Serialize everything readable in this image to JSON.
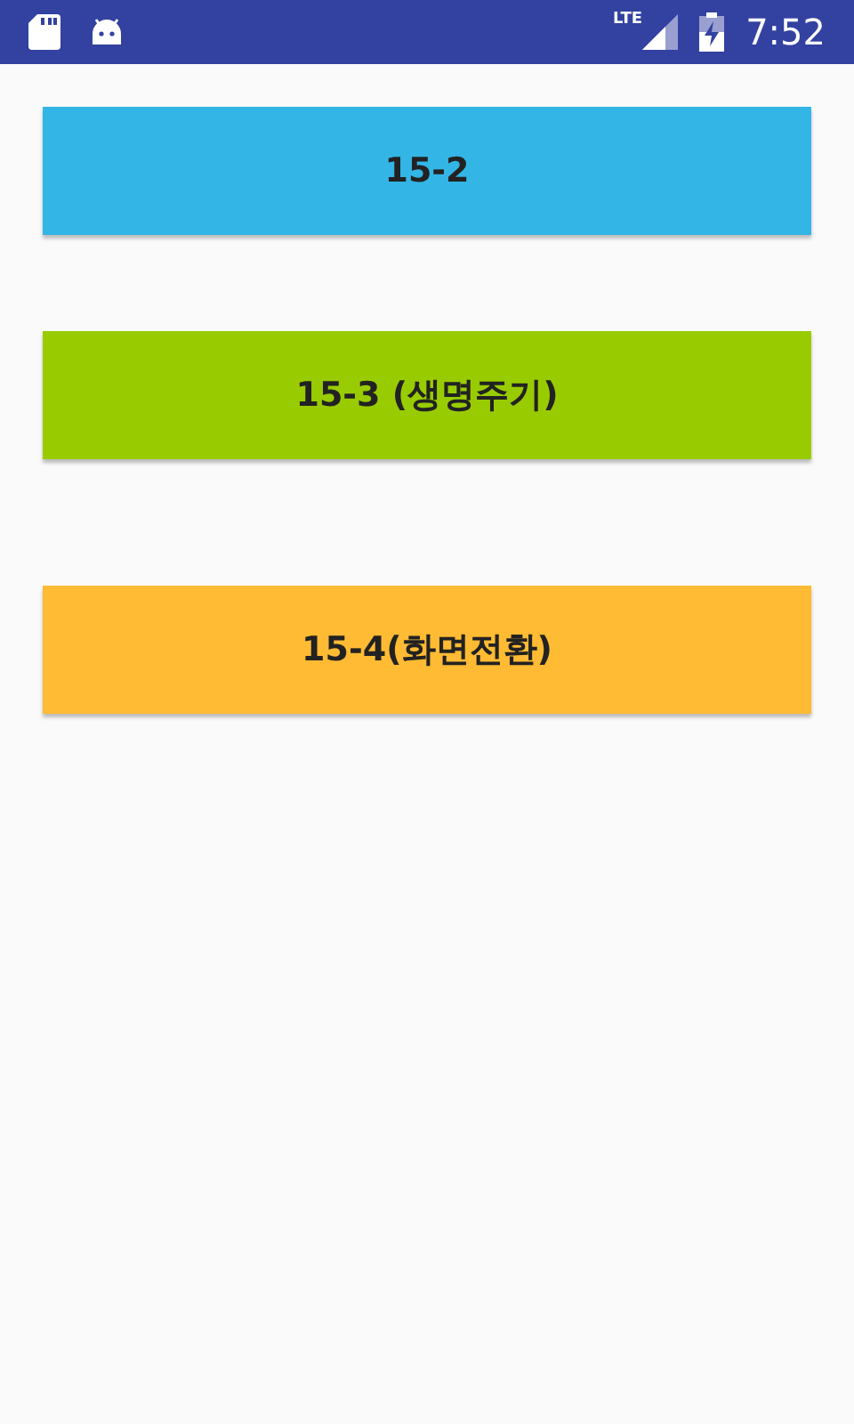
{
  "status_bar": {
    "network": "LTE",
    "time": "7:52"
  },
  "buttons": [
    {
      "label": "15-2",
      "color": "#33b5e5"
    },
    {
      "label": "15-3 (생명주기)",
      "color": "#99cc00"
    },
    {
      "label": "15-4(화면전환)",
      "color": "#ffbb33"
    }
  ]
}
